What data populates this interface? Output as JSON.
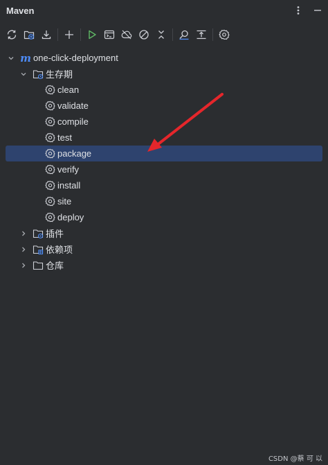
{
  "panel": {
    "title": "Maven",
    "menu_icon": "more-vertical-icon",
    "minimize_icon": "minimize-icon"
  },
  "toolbar": {
    "buttons": [
      {
        "name": "reload-all-projects-button",
        "icon": "reload-icon"
      },
      {
        "name": "add-maven-project-button",
        "icon": "add-project-folder-icon"
      },
      {
        "name": "download-sources-button",
        "icon": "download-icon"
      },
      {
        "name": "add-button",
        "icon": "plus-icon"
      },
      {
        "name": "run-maven-build-button",
        "icon": "play-icon"
      },
      {
        "name": "execute-maven-goal-button",
        "icon": "terminal-icon"
      },
      {
        "name": "toggle-offline-mode-button",
        "icon": "cloud-off-icon"
      },
      {
        "name": "skip-tests-button",
        "icon": "no-entry-icon"
      },
      {
        "name": "collapse-all-button",
        "icon": "collapse-icon"
      },
      {
        "name": "show-dependencies-button",
        "icon": "analyze-icon"
      },
      {
        "name": "toggle-diagram-button",
        "icon": "align-icon"
      },
      {
        "name": "settings-button",
        "icon": "gear-icon"
      }
    ]
  },
  "tree": {
    "project": {
      "label": "one-click-deployment",
      "logo": "m",
      "expanded": true
    },
    "lifecycle": {
      "label": "生存期",
      "expanded": true,
      "goals": [
        "clean",
        "validate",
        "compile",
        "test",
        "package",
        "verify",
        "install",
        "site",
        "deploy"
      ],
      "selected": "package"
    },
    "plugins": {
      "label": "插件",
      "expanded": false
    },
    "dependencies": {
      "label": "依赖项",
      "expanded": false
    },
    "repositories": {
      "label": "仓库",
      "expanded": false
    }
  },
  "colors": {
    "background": "#2b2d30",
    "selection": "#2e436e",
    "text": "#dfe1e5",
    "accent": "#4d8bf5",
    "run_green": "#5fb865",
    "annotation_arrow": "#e5262b"
  },
  "watermark": "CSDN @蔡 可 以"
}
